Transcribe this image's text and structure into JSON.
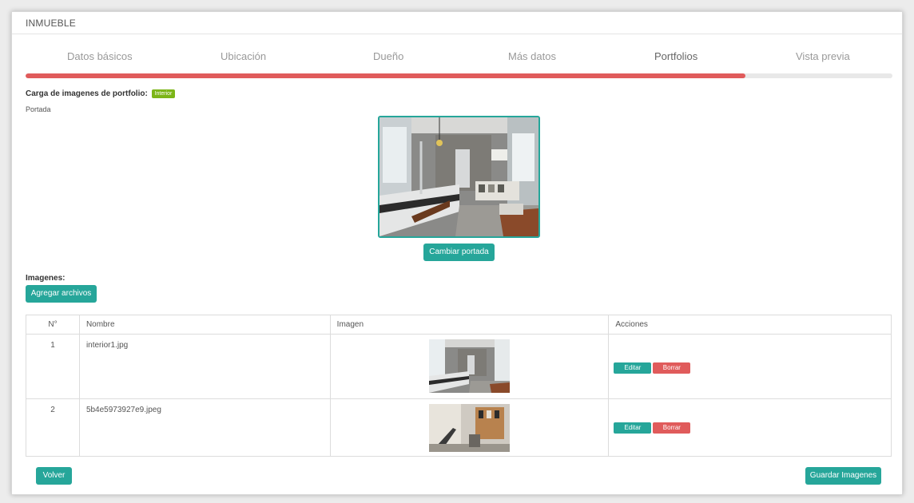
{
  "window": {
    "title": "INMUEBLE"
  },
  "steps": [
    {
      "label": "Datos básicos",
      "active": false
    },
    {
      "label": "Ubicación",
      "active": false
    },
    {
      "label": "Dueño",
      "active": false
    },
    {
      "label": "Más datos",
      "active": false
    },
    {
      "label": "Portfolios",
      "active": true
    },
    {
      "label": "Vista previa",
      "active": false
    }
  ],
  "progress": {
    "percent": 83,
    "color": "#e05b5b"
  },
  "portfolio": {
    "heading": "Carga de imagenes de portfolio:",
    "category_badge": "Interior",
    "cover_label": "Portada",
    "change_cover_button": "Cambiar portada"
  },
  "images": {
    "heading": "Imagenes:",
    "add_files_button": "Agregar archivos",
    "columns": [
      "N°",
      "Nombre",
      "Imagen",
      "Acciones"
    ],
    "rows": [
      {
        "n": "1",
        "name": "interior1.jpg"
      },
      {
        "n": "2",
        "name": "5b4e5973927e9.jpeg"
      }
    ],
    "edit_label": "Editar",
    "delete_label": "Borrar"
  },
  "footer": {
    "back_button": "Volver",
    "save_button": "Guardar Imagenes"
  },
  "colors": {
    "accent": "#26a69a",
    "danger": "#e05b5b",
    "badge": "#7cb518"
  }
}
